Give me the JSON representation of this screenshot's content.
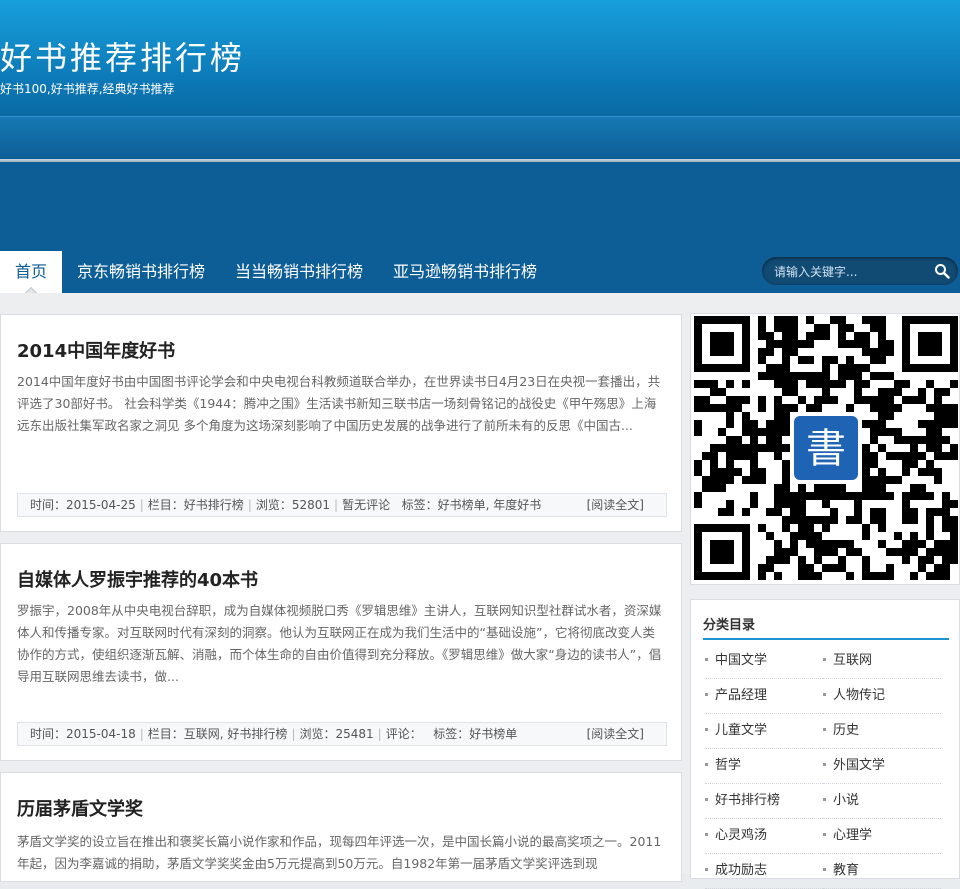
{
  "site": {
    "title": "好书推荐排行榜",
    "description": "好书100,好书推荐,经典好书推荐"
  },
  "nav": {
    "items": [
      {
        "label": "首页",
        "active": true
      },
      {
        "label": "京东畅销书排行榜"
      },
      {
        "label": "当当畅销书排行榜"
      },
      {
        "label": "亚马逊畅销书排行榜"
      }
    ]
  },
  "search": {
    "placeholder": "请输入关键字..."
  },
  "posts": [
    {
      "title": "2014中国年度好书",
      "excerpt": "2014中国年度好书由中国图书评论学会和中央电视台科教频道联合举办，在世界读书日4月23日在央视一套播出，共评选了30部好书。 社会科学类《1944：腾冲之围》生活读书新知三联书店一场刻骨铭记的战役史《甲午殇思》上海远东出版社集军政名家之洞见 多个角度为这场深刻影响了中国历史发展的战争进行了前所未有的反思《中国古...",
      "time": "时间：2015-04-25",
      "column": "栏目：好书排行榜",
      "views": "浏览：52801",
      "comments": "暂无评论",
      "tags": "标签：好书榜单, 年度好书",
      "read_more": "[阅读全文]"
    },
    {
      "title": "自媒体人罗振宇推荐的40本书",
      "excerpt": "罗振宇，2008年从中央电视台辞职，成为自媒体视频脱口秀《罗辑思维》主讲人，互联网知识型社群试水者，资深媒体人和传播专家。对互联网时代有深刻的洞察。他认为互联网正在成为我们生活中的“基础设施”，它将彻底改变人类协作的方式，使组织逐渐瓦解、消融，而个体生命的自由价值得到充分释放。《罗辑思维》做大家“身边的读书人”，倡导用互联网思维去读书，做...",
      "time": "时间：2015-04-18",
      "column": "栏目：互联网, 好书排行榜",
      "views": "浏览：25481",
      "comments": "评论：",
      "tags": "标签：好书榜单",
      "read_more": "[阅读全文]"
    },
    {
      "title": "历届茅盾文学奖",
      "excerpt": "茅盾文学奖的设立旨在推出和褒奖长篇小说作家和作品，现每四年评选一次，是中国长篇小说的最高奖项之一。2011年起，因为李嘉诚的捐助，茅盾文学奖奖金由5万元提高到50万元。自1982年第一届茅盾文学奖评选到现"
    }
  ],
  "sidebar": {
    "categories_title": "分类目录",
    "categories": [
      "中国文学",
      "互联网",
      "产品经理",
      "人物传记",
      "儿童文学",
      "历史",
      "哲学",
      "外国文学",
      "好书排行榜",
      "小说",
      "心灵鸡汤",
      "心理学",
      "成功励志",
      "教育"
    ],
    "qr_logo_char": "書"
  }
}
